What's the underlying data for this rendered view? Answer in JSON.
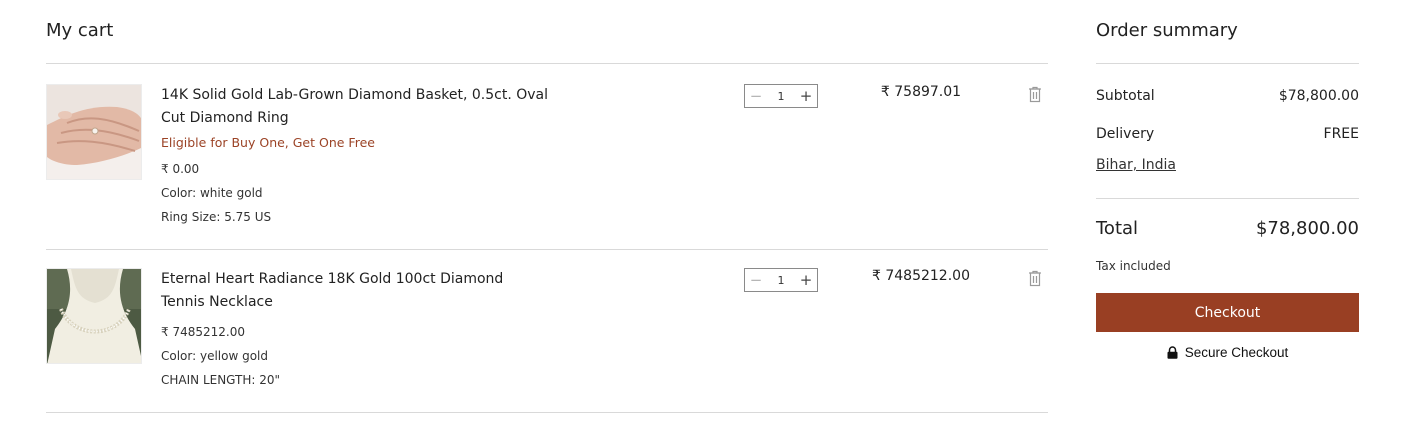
{
  "cart": {
    "title": "My cart",
    "items": [
      {
        "name": "14K Solid Gold Lab-Grown Diamond Basket, 0.5ct. Oval Cut Diamond Ring",
        "promo": "Eligible for Buy One, Get One Free",
        "unit_price": "₹ 0.00",
        "options": [
          "Color: white gold",
          "Ring Size: 5.75 US"
        ],
        "quantity": "1",
        "line_total": "₹ 75897.01",
        "image_icon": "ring-on-hand-photo"
      },
      {
        "name": "Eternal Heart Radiance 18K Gold 100ct Diamond Tennis Necklace",
        "unit_price": "₹ 7485212.00",
        "options": [
          "Color: yellow gold",
          "CHAIN LENGTH: 20\""
        ],
        "quantity": "1",
        "line_total": "₹ 7485212.00",
        "image_icon": "necklace-on-bust-photo"
      }
    ]
  },
  "summary": {
    "title": "Order summary",
    "subtotal_label": "Subtotal",
    "subtotal_value": "$78,800.00",
    "delivery_label": "Delivery",
    "delivery_value": "FREE",
    "location": "Bihar, India",
    "total_label": "Total",
    "total_value": "$78,800.00",
    "tax_note": "Tax included",
    "checkout_label": "Checkout",
    "secure_label": "Secure Checkout"
  },
  "colors": {
    "accent": "#993f23",
    "promo_text": "#9b4326",
    "divider": "#d9d9d9"
  }
}
